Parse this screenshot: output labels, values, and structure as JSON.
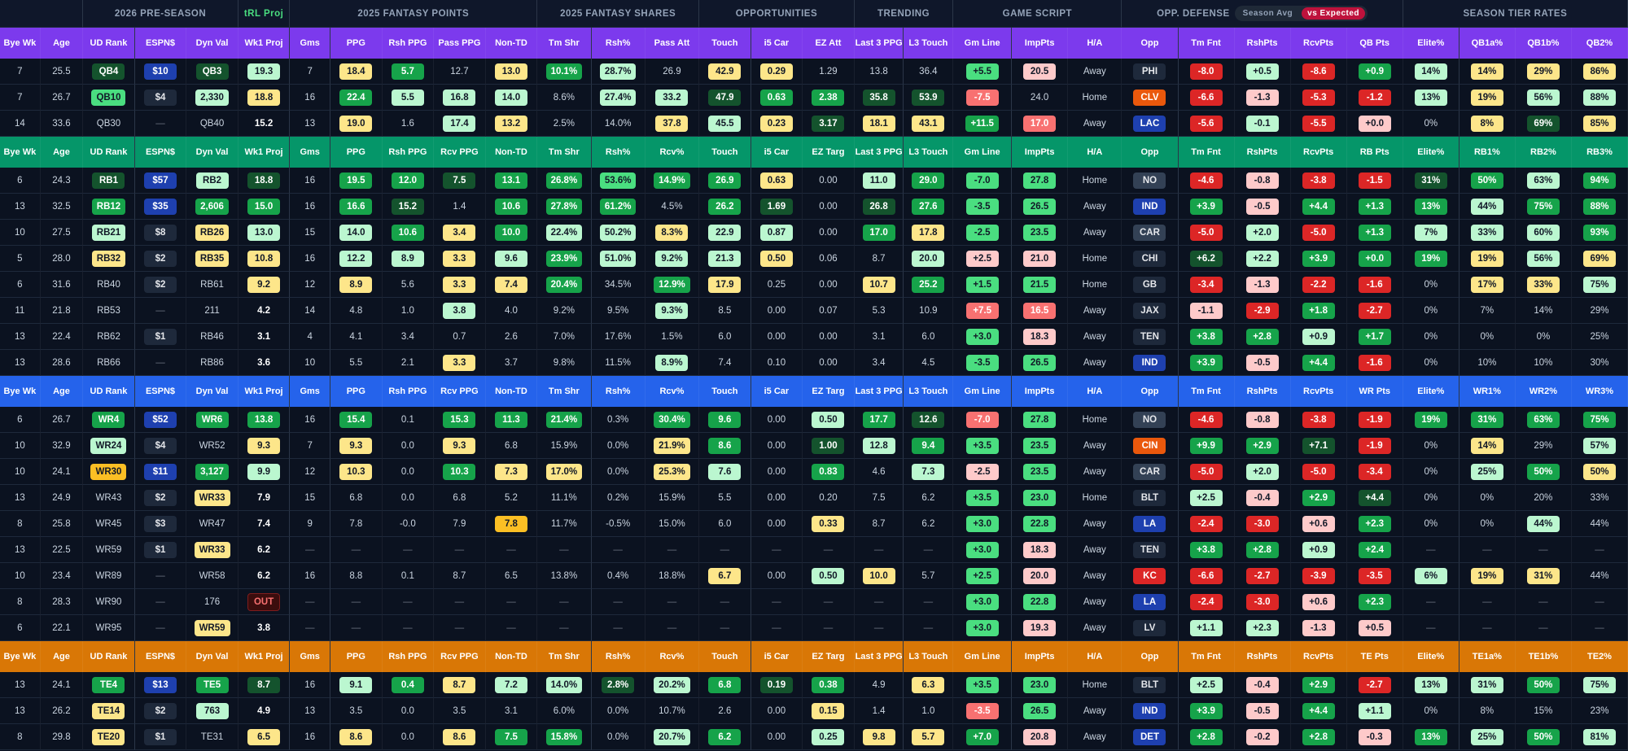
{
  "groups": [
    {
      "label": "",
      "span": 2
    },
    {
      "label": "2026 PRE-SEASON",
      "span": 3
    },
    {
      "label": "tRL Proj",
      "span": 1,
      "cls": "proj"
    },
    {
      "label": "2025 FANTASY POINTS",
      "span": 5
    },
    {
      "label": "2025 FANTASY SHARES",
      "span": 3
    },
    {
      "label": "OPPORTUNITIES",
      "span": 3
    },
    {
      "label": "TRENDING",
      "span": 2
    },
    {
      "label": "GAME SCRIPT",
      "span": 3
    },
    {
      "label": "OPP. DEFENSE",
      "span": 5,
      "toggle": [
        "Season Avg",
        "vs Expected"
      ],
      "toggle_active": 1
    },
    {
      "label": "SEASON TIER RATES",
      "span": 4
    }
  ],
  "palette": {
    "c1": "#14532d",
    "c2": "#16a34a",
    "c3": "#4ade80",
    "c4": "#bbf7d0",
    "c5": "#fde68a",
    "c6": "#fbbf24",
    "c7": "#fecaca",
    "c8": "#f87171",
    "c9": "#dc2626",
    "c10": "#166534",
    "c11": "#22c55e",
    "sp": "#1e293b",
    "sp_blue": "#1e40af",
    "sp_red": "#dc2626",
    "sp_orange": "#ea580c",
    "sp_gray": "#334155"
  },
  "sections": [
    {
      "color": "#7c3aed",
      "headers": [
        "Bye Wk",
        "Age",
        "UD Rank",
        "ESPN$",
        "Dyn Val",
        "Wk1 Proj",
        "Gms",
        "PPG",
        "Rsh PPG",
        "Pass PPG",
        "Non-TD",
        "Tm Shr",
        "Rsh%",
        "Pass Att",
        "Touch",
        "i5 Car",
        "EZ Att",
        "Last 3 PPG",
        "L3 Touch",
        "Gm Line",
        "ImpPts",
        "H/A",
        "Opp",
        "Tm Fnt",
        "RshPts",
        "RcvPts",
        "QB Pts",
        "Elite%",
        "QB1a%",
        "QB1b%",
        "QB2%"
      ],
      "rows": [
        [
          "7",
          "25.5",
          "QB4|c1",
          "$10|sp_blue",
          "QB3|c1",
          "19.3|c4",
          "7",
          "18.4|c5",
          "5.7|c2",
          "12.7",
          "13.0|c5",
          "10.1%|c2",
          "28.7%|c4",
          "26.9",
          "42.9|c5",
          "0.29|c5",
          "1.29",
          "13.8",
          "36.4",
          "+5.5|c3",
          "20.5|c7",
          "Away",
          "PHI|sp",
          "-8.0|c9",
          "+0.5|c4",
          "-8.6|c9",
          "+0.9|c2",
          "14%|c4",
          "14%|c5",
          "29%|c5",
          "86%|c5"
        ],
        [
          "7",
          "26.7",
          "QB10|c3",
          "$4|sp",
          "2,330|c4",
          "18.8|c5",
          "16",
          "22.4|c2",
          "5.5|c4",
          "16.8|c4",
          "14.0|c4",
          "8.6%",
          "27.4%|c4",
          "33.2|c4",
          "47.9|c1",
          "0.63|c2",
          "2.38|c2",
          "35.8|c1",
          "53.9|c1",
          "-7.5|c8",
          "24.0",
          "Home",
          "CLV|sp_orange",
          "-6.6|c9",
          "-1.3|c7",
          "-5.3|c9",
          "-1.2|c9",
          "13%|c4",
          "19%|c5",
          "56%|c4",
          "88%|c4"
        ],
        [
          "14",
          "33.6",
          "QB30",
          "—",
          "QB40",
          "15.2",
          "13",
          "19.0|c5",
          "1.6",
          "17.4|c4",
          "13.2|c5",
          "2.5%",
          "14.0%",
          "37.8|c5",
          "45.5|c4",
          "0.23|c5",
          "3.17|c1",
          "18.1|c5",
          "43.1|c5",
          "+11.5|c2",
          "17.0|c8",
          "Away",
          "LAC|sp_blue",
          "-5.6|c9",
          "-0.1|c4",
          "-5.5|c9",
          "+0.0|c7",
          "0%",
          "8%|c5",
          "69%|c1",
          "85%|c5"
        ]
      ]
    },
    {
      "color": "#059669",
      "headers": [
        "Bye Wk",
        "Age",
        "UD Rank",
        "ESPN$",
        "Dyn Val",
        "Wk1 Proj",
        "Gms",
        "PPG",
        "Rsh PPG",
        "Rcv PPG",
        "Non-TD",
        "Tm Shr",
        "Rsh%",
        "Rcv%",
        "Touch",
        "i5 Car",
        "EZ Targ",
        "Last 3 PPG",
        "L3 Touch",
        "Gm Line",
        "ImpPts",
        "H/A",
        "Opp",
        "Tm Fnt",
        "RshPts",
        "RcvPts",
        "RB Pts",
        "Elite%",
        "RB1%",
        "RB2%",
        "RB3%"
      ],
      "rows": [
        [
          "6",
          "24.3",
          "RB1|c1",
          "$57|sp_blue",
          "RB2|c4",
          "18.8|c1",
          "16",
          "19.5|c2",
          "12.0|c2",
          "7.5|c1",
          "13.1|c2",
          "26.8%|c2",
          "53.6%|c3",
          "14.9%|c2",
          "26.9|c2",
          "0.63|c5",
          "0.00",
          "11.0|c4",
          "29.0|c2",
          "-7.0|c3",
          "27.8|c3",
          "Home",
          "NO|sp_gray",
          "-4.6|c9",
          "-0.8|c7",
          "-3.8|c9",
          "-1.5|c9",
          "31%|c1",
          "50%|c2",
          "63%|c4",
          "94%|c2"
        ],
        [
          "13",
          "32.5",
          "RB12|c2",
          "$35|sp_blue",
          "2,606|c2",
          "15.0|c2",
          "16",
          "16.6|c2",
          "15.2|c1",
          "1.4",
          "10.6|c2",
          "27.8%|c2",
          "61.2%|c2",
          "4.5%",
          "26.2|c2",
          "1.69|c1",
          "0.00",
          "26.8|c1",
          "27.6|c2",
          "-3.5|c3",
          "26.5|c3",
          "Away",
          "IND|sp_blue",
          "+3.9|c2",
          "-0.5|c7",
          "+4.4|c2",
          "+1.3|c2",
          "13%|c2",
          "44%|c4",
          "75%|c2",
          "88%|c2"
        ],
        [
          "10",
          "27.5",
          "RB21|c4",
          "$8|sp",
          "RB26|c5",
          "13.0|c4",
          "15",
          "14.0|c4",
          "10.6|c2",
          "3.4|c5",
          "10.0|c2",
          "22.4%|c4",
          "50.2%|c4",
          "8.3%|c5",
          "22.9|c4",
          "0.87|c4",
          "0.00",
          "17.0|c2",
          "17.8|c5",
          "-2.5|c3",
          "23.5|c3",
          "Away",
          "CAR|sp_gray",
          "-5.0|c9",
          "+2.0|c4",
          "-5.0|c9",
          "+1.3|c2",
          "7%|c4",
          "33%|c4",
          "60%|c4",
          "93%|c2"
        ],
        [
          "5",
          "28.0",
          "RB32|c5",
          "$2|sp",
          "RB35|c5",
          "10.8|c5",
          "16",
          "12.2|c4",
          "8.9|c4",
          "3.3|c5",
          "9.6|c4",
          "23.9%|c2",
          "51.0%|c4",
          "9.2%|c4",
          "21.3|c4",
          "0.50|c5",
          "0.06",
          "8.7",
          "20.0|c4",
          "+2.5|c7",
          "21.0|c7",
          "Home",
          "CHI|sp",
          "+6.2|c1",
          "+2.2|c4",
          "+3.9|c2",
          "+0.0|c2",
          "19%|c2",
          "19%|c5",
          "56%|c4",
          "69%|c5"
        ],
        [
          "6",
          "31.6",
          "RB40",
          "$2|sp",
          "RB61",
          "9.2|c5",
          "12",
          "8.9|c5",
          "5.6",
          "3.3|c5",
          "7.4|c5",
          "20.4%|c2",
          "34.5%",
          "12.9%|c2",
          "17.9|c5",
          "0.25",
          "0.00",
          "10.7|c5",
          "25.2|c2",
          "+1.5|c3",
          "21.5|c3",
          "Home",
          "GB|sp",
          "-3.4|c9",
          "-1.3|c7",
          "-2.2|c9",
          "-1.6|c9",
          "0%",
          "17%|c5",
          "33%|c5",
          "75%|c4"
        ],
        [
          "11",
          "21.8",
          "RB53",
          "—",
          "211",
          "4.2",
          "14",
          "4.8",
          "1.0",
          "3.8|c4",
          "4.0",
          "9.2%",
          "9.5%",
          "9.3%|c4",
          "8.5",
          "0.00",
          "0.07",
          "5.3",
          "10.9",
          "+7.5|c8",
          "16.5|c8",
          "Away",
          "JAX|sp",
          "-1.1|c7",
          "-2.9|c9",
          "+1.8|c2",
          "-2.7|c9",
          "0%",
          "7%",
          "14%",
          "29%"
        ],
        [
          "13",
          "22.4",
          "RB62",
          "$1|sp",
          "RB46",
          "3.1",
          "4",
          "4.1",
          "3.4",
          "0.7",
          "2.6",
          "7.0%",
          "17.6%",
          "1.5%",
          "6.0",
          "0.00",
          "0.00",
          "3.1",
          "6.0",
          "+3.0|c3",
          "18.3|c7",
          "Away",
          "TEN|sp",
          "+3.8|c2",
          "+2.8|c2",
          "+0.9|c4",
          "+1.7|c2",
          "0%",
          "0%",
          "0%",
          "25%"
        ],
        [
          "13",
          "28.6",
          "RB66",
          "—",
          "RB86",
          "3.6",
          "10",
          "5.5",
          "2.1",
          "3.3|c5",
          "3.7",
          "9.8%",
          "11.5%",
          "8.9%|c4",
          "7.4",
          "0.10",
          "0.00",
          "3.4",
          "4.5",
          "-3.5|c3",
          "26.5|c3",
          "Away",
          "IND|sp_blue",
          "+3.9|c2",
          "-0.5|c7",
          "+4.4|c2",
          "-1.6|c9",
          "0%",
          "10%",
          "10%",
          "30%"
        ]
      ]
    },
    {
      "color": "#2563eb",
      "headers": [
        "Bye Wk",
        "Age",
        "UD Rank",
        "ESPN$",
        "Dyn Val",
        "Wk1 Proj",
        "Gms",
        "PPG",
        "Rsh PPG",
        "Rcv PPG",
        "Non-TD",
        "Tm Shr",
        "Rsh%",
        "Rcv%",
        "Touch",
        "i5 Car",
        "EZ Targ",
        "Last 3 PPG",
        "L3 Touch",
        "Gm Line",
        "ImpPts",
        "H/A",
        "Opp",
        "Tm Fnt",
        "RshPts",
        "RcvPts",
        "WR Pts",
        "Elite%",
        "WR1%",
        "WR2%",
        "WR3%"
      ],
      "rows": [
        [
          "6",
          "26.7",
          "WR4|c2",
          "$52|sp_blue",
          "WR6|c2",
          "13.8|c2",
          "16",
          "15.4|c2",
          "0.1",
          "15.3|c2",
          "11.3|c2",
          "21.4%|c2",
          "0.3%",
          "30.4%|c2",
          "9.6|c2",
          "0.00",
          "0.50|c4",
          "17.7|c2",
          "12.6|c1",
          "-7.0|c8",
          "27.8|c3",
          "Home",
          "NO|sp_gray",
          "-4.6|c9",
          "-0.8|c7",
          "-3.8|c9",
          "-1.9|c9",
          "19%|c2",
          "31%|c2",
          "63%|c2",
          "75%|c2"
        ],
        [
          "10",
          "32.9",
          "WR24|c4",
          "$4|sp",
          "WR52",
          "9.3|c5",
          "7",
          "9.3|c5",
          "0.0",
          "9.3|c5",
          "6.8",
          "15.9%",
          "0.0%",
          "21.9%|c5",
          "8.6|c2",
          "0.00",
          "1.00|c1",
          "12.8|c4",
          "9.4|c2",
          "+3.5|c3",
          "23.5|c3",
          "Away",
          "CIN|sp_orange",
          "+9.9|c2",
          "+2.9|c2",
          "+7.1|c1",
          "-1.9|c9",
          "0%",
          "14%|c5",
          "29%",
          "57%|c4"
        ],
        [
          "10",
          "24.1",
          "WR30|c6",
          "$11|sp_blue",
          "3,127|c2",
          "9.9|c4",
          "12",
          "10.3|c5",
          "0.0",
          "10.3|c2",
          "7.3|c5",
          "17.0%|c5",
          "0.0%",
          "25.3%|c5",
          "7.6|c4",
          "0.00",
          "0.83|c2",
          "4.6",
          "7.3|c4",
          "-2.5|c7",
          "23.5|c3",
          "Away",
          "CAR|sp_gray",
          "-5.0|c9",
          "+2.0|c4",
          "-5.0|c9",
          "-3.4|c9",
          "0%",
          "25%|c4",
          "50%|c2",
          "50%|c5"
        ],
        [
          "13",
          "24.9",
          "WR43",
          "$2|sp",
          "WR33|c5",
          "7.9",
          "15",
          "6.8",
          "0.0",
          "6.8",
          "5.2",
          "11.1%",
          "0.2%",
          "15.9%",
          "5.5",
          "0.00",
          "0.20",
          "7.5",
          "6.2",
          "+3.5|c3",
          "23.0|c3",
          "Home",
          "BLT|sp",
          "+2.5|c4",
          "-0.4|c7",
          "+2.9|c2",
          "+4.4|c1",
          "0%",
          "0%",
          "20%",
          "33%"
        ],
        [
          "8",
          "25.8",
          "WR45",
          "$3|sp",
          "WR47",
          "7.4",
          "9",
          "7.8",
          "-0.0",
          "7.9",
          "7.8|c6",
          "11.7%",
          "-0.5%",
          "15.0%",
          "6.0",
          "0.00",
          "0.33|c5",
          "8.7",
          "6.2",
          "+3.0|c3",
          "22.8|c3",
          "Away",
          "LA|sp_blue",
          "-2.4|c9",
          "-3.0|c9",
          "+0.6|c7",
          "+2.3|c2",
          "0%",
          "0%",
          "44%|c4",
          "44%"
        ],
        [
          "13",
          "22.5",
          "WR59",
          "$1|sp",
          "WR33|c5",
          "6.2",
          "—",
          "—",
          "—",
          "—",
          "—",
          "—",
          "—",
          "—",
          "—",
          "—",
          "—",
          "—",
          "—",
          "+3.0|c3",
          "18.3|c7",
          "Away",
          "TEN|sp",
          "+3.8|c2",
          "+2.8|c2",
          "+0.9|c4",
          "+2.4|c2",
          "—",
          "—",
          "—",
          "—"
        ],
        [
          "10",
          "23.4",
          "WR89",
          "—",
          "WR58",
          "6.2",
          "16",
          "8.8",
          "0.1",
          "8.7",
          "6.5",
          "13.8%",
          "0.4%",
          "18.8%",
          "6.7|c5",
          "0.00",
          "0.50|c4",
          "10.0|c5",
          "5.7",
          "+2.5|c3",
          "20.0|c7",
          "Away",
          "KC|sp_red",
          "-6.6|c9",
          "-2.7|c9",
          "-3.9|c9",
          "-3.5|c9",
          "6%|c4",
          "19%|c5",
          "31%|c5",
          "44%"
        ],
        [
          "8",
          "28.3",
          "WR90",
          "—",
          "176",
          "OUT|out",
          "—",
          "—",
          "—",
          "—",
          "—",
          "—",
          "—",
          "—",
          "—",
          "—",
          "—",
          "—",
          "—",
          "+3.0|c3",
          "22.8|c3",
          "Away",
          "LA|sp_blue",
          "-2.4|c9",
          "-3.0|c9",
          "+0.6|c7",
          "+2.3|c2",
          "—",
          "—",
          "—",
          "—"
        ],
        [
          "6",
          "22.1",
          "WR95",
          "—",
          "WR59|c5",
          "3.8",
          "—",
          "—",
          "—",
          "—",
          "—",
          "—",
          "—",
          "—",
          "—",
          "—",
          "—",
          "—",
          "—",
          "+3.0|c3",
          "19.3|c7",
          "Away",
          "LV|sp",
          "+1.1|c4",
          "+2.3|c4",
          "-1.3|c7",
          "+0.5|c7",
          "—",
          "—",
          "—",
          "—"
        ]
      ]
    },
    {
      "color": "#d97706",
      "headers": [
        "Bye Wk",
        "Age",
        "UD Rank",
        "ESPN$",
        "Dyn Val",
        "Wk1 Proj",
        "Gms",
        "PPG",
        "Rsh PPG",
        "Rcv PPG",
        "Non-TD",
        "Tm Shr",
        "Rsh%",
        "Rcv%",
        "Touch",
        "i5 Car",
        "EZ Targ",
        "Last 3 PPG",
        "L3 Touch",
        "Gm Line",
        "ImpPts",
        "H/A",
        "Opp",
        "Tm Fnt",
        "RshPts",
        "RcvPts",
        "TE Pts",
        "Elite%",
        "TE1a%",
        "TE1b%",
        "TE2%"
      ],
      "rows": [
        [
          "13",
          "24.1",
          "TE4|c2",
          "$13|sp_blue",
          "TE5|c2",
          "8.7|c1",
          "16",
          "9.1|c4",
          "0.4|c2",
          "8.7|c5",
          "7.2|c4",
          "14.0%|c4",
          "2.8%|c1",
          "20.2%|c4",
          "6.8|c2",
          "0.19|c1",
          "0.38|c2",
          "4.9",
          "6.3|c5",
          "+3.5|c3",
          "23.0|c3",
          "Home",
          "BLT|sp",
          "+2.5|c4",
          "-0.4|c7",
          "+2.9|c2",
          "-2.7|c9",
          "13%|c4",
          "31%|c4",
          "50%|c2",
          "75%|c4"
        ],
        [
          "13",
          "26.2",
          "TE14|c5",
          "$2|sp",
          "763|c4",
          "4.9",
          "13",
          "3.5",
          "0.0",
          "3.5",
          "3.1",
          "6.0%",
          "0.0%",
          "10.7%",
          "2.6",
          "0.00",
          "0.15|c5",
          "1.4",
          "1.0",
          "-3.5|c8",
          "26.5|c3",
          "Away",
          "IND|sp_blue",
          "+3.9|c2",
          "-0.5|c7",
          "+4.4|c2",
          "+1.1|c4",
          "0%",
          "8%",
          "15%",
          "23%"
        ],
        [
          "8",
          "29.8",
          "TE20|c5",
          "$1|sp",
          "TE31",
          "6.5|c5",
          "16",
          "8.6|c5",
          "0.0",
          "8.6|c5",
          "7.5|c2",
          "15.8%|c2",
          "0.0%",
          "20.7%|c4",
          "6.2|c2",
          "0.00",
          "0.25|c4",
          "9.8|c5",
          "5.7|c5",
          "+7.0|c2",
          "20.8|c7",
          "Away",
          "DET|sp_blue",
          "+2.8|c2",
          "-0.2|c7",
          "+2.8|c2",
          "-0.3|c7",
          "13%|c2",
          "25%|c4",
          "50%|c2",
          "81%|c4"
        ]
      ]
    }
  ]
}
